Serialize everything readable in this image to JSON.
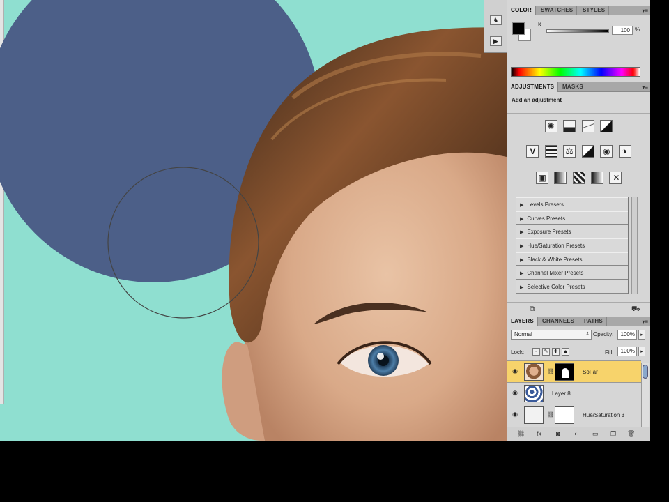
{
  "colors": {
    "canvas_bg": "#8fdfd0",
    "circle_fill": "#4c5f88",
    "panel_bg": "#d6d6d6",
    "selected_layer": "#f7d36b"
  },
  "canvas": {
    "elements": [
      "blue-circle",
      "brush-cursor",
      "portrait-photo"
    ]
  },
  "toolstrip": {
    "icons": [
      "footprints-icon",
      "play-icon"
    ]
  },
  "color_panel": {
    "tabs": [
      "COLOR",
      "SWATCHES",
      "STYLES"
    ],
    "channel_label": "K",
    "value": "100",
    "unit": "%"
  },
  "adjustments_panel": {
    "tabs": [
      "ADJUSTMENTS",
      "MASKS"
    ],
    "title": "Add an adjustment",
    "presets": [
      "Levels Presets",
      "Curves Presets",
      "Exposure Presets",
      "Hue/Saturation Presets",
      "Black & White Presets",
      "Channel Mixer Presets",
      "Selective Color Presets"
    ]
  },
  "layers_panel": {
    "tabs": [
      "LAYERS",
      "CHANNELS",
      "PATHS"
    ],
    "blend_mode": "Normal",
    "opacity_label": "Opacity:",
    "opacity": "100%",
    "lock_label": "Lock:",
    "fill_label": "Fill:",
    "fill": "100%",
    "layers": [
      {
        "name": "SoFar",
        "selected": true
      },
      {
        "name": "Layer 8",
        "selected": false
      },
      {
        "name": "Hue/Saturation 3",
        "selected": false
      }
    ]
  }
}
